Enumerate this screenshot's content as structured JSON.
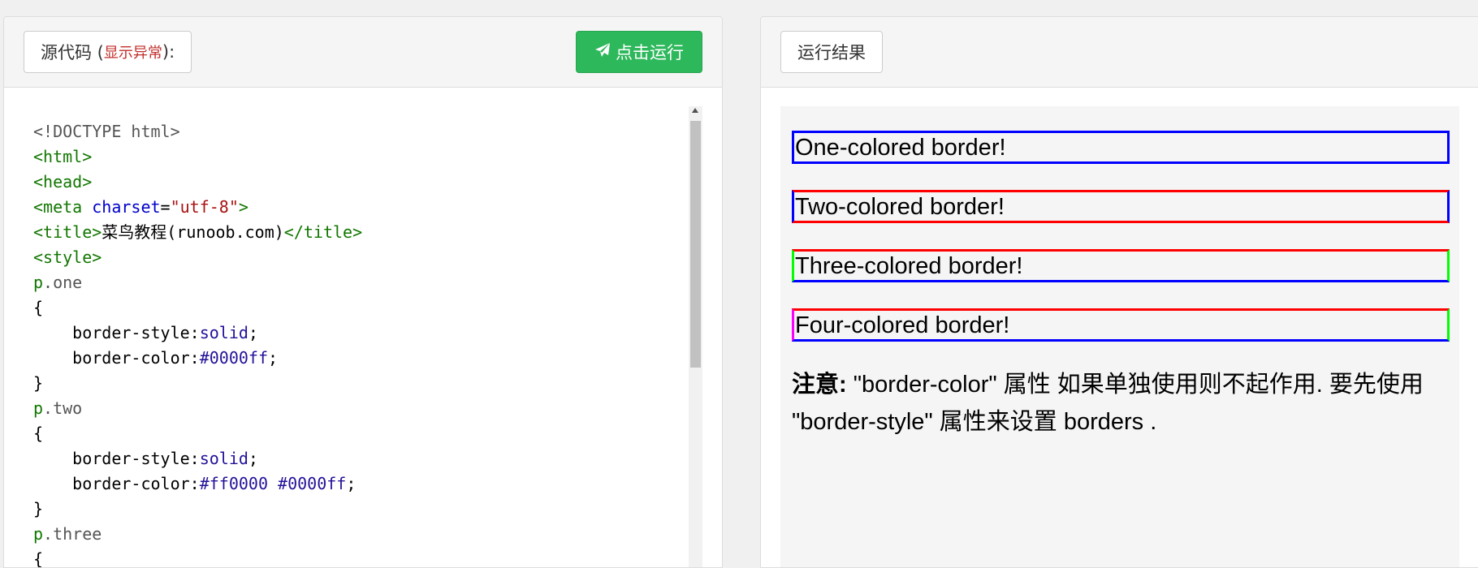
{
  "source_panel": {
    "label_prefix": "源代码 (",
    "label_error": "显示异常",
    "label_suffix": "):",
    "run_button_label": "点击运行",
    "code_lines": [
      [
        {
          "t": "<!DOCTYPE html>",
          "c": "doctype"
        }
      ],
      [
        {
          "t": "<html>",
          "c": "tag"
        }
      ],
      [
        {
          "t": "<head>",
          "c": "tag"
        }
      ],
      [
        {
          "t": "<meta ",
          "c": "tag"
        },
        {
          "t": "charset",
          "c": "attr"
        },
        {
          "t": "=",
          "c": "text"
        },
        {
          "t": "\"utf-8\"",
          "c": "str"
        },
        {
          "t": ">",
          "c": "tag"
        }
      ],
      [
        {
          "t": "<title>",
          "c": "tag"
        },
        {
          "t": "菜鸟教程(runoob.com)",
          "c": "text"
        },
        {
          "t": "</title>",
          "c": "tag"
        }
      ],
      [
        {
          "t": "<style>",
          "c": "tag"
        }
      ],
      [
        {
          "t": "p",
          "c": "sel"
        },
        {
          "t": ".one",
          "c": "cls"
        }
      ],
      [
        {
          "t": "{",
          "c": "text"
        }
      ],
      [
        {
          "t": "    border-style:",
          "c": "prop"
        },
        {
          "t": "solid",
          "c": "val"
        },
        {
          "t": ";",
          "c": "text"
        }
      ],
      [
        {
          "t": "    border-color:",
          "c": "prop"
        },
        {
          "t": "#0000ff",
          "c": "val"
        },
        {
          "t": ";",
          "c": "text"
        }
      ],
      [
        {
          "t": "}",
          "c": "text"
        }
      ],
      [
        {
          "t": "p",
          "c": "sel"
        },
        {
          "t": ".two",
          "c": "cls"
        }
      ],
      [
        {
          "t": "{",
          "c": "text"
        }
      ],
      [
        {
          "t": "    border-style:",
          "c": "prop"
        },
        {
          "t": "solid",
          "c": "val"
        },
        {
          "t": ";",
          "c": "text"
        }
      ],
      [
        {
          "t": "    border-color:",
          "c": "prop"
        },
        {
          "t": "#ff0000 #0000ff",
          "c": "val"
        },
        {
          "t": ";",
          "c": "text"
        }
      ],
      [
        {
          "t": "}",
          "c": "text"
        }
      ],
      [
        {
          "t": "p",
          "c": "sel"
        },
        {
          "t": ".three",
          "c": "cls"
        }
      ],
      [
        {
          "t": "{",
          "c": "text"
        }
      ]
    ]
  },
  "result_panel": {
    "label": "运行结果",
    "paragraphs": {
      "one": "One-colored border!",
      "two": "Two-colored border!",
      "three": "Three-colored border!",
      "four": "Four-colored border!"
    },
    "note_bold": "注意:",
    "note_text": " \"border-color\" 属性 如果单独使用则不起作用. 要先使用 \"border-style\" 属性来设置 borders ."
  },
  "colors": {
    "run_button": "#2eb85c",
    "error_label": "#c12e2a",
    "blue": "#0000ff",
    "red": "#ff0000",
    "green": "#00ff00",
    "magenta": "#ff00ff"
  },
  "icons": {
    "run_button_icon": "paper-plane-icon"
  }
}
